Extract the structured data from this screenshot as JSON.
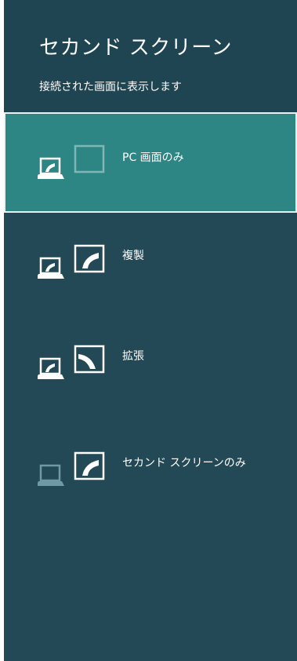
{
  "panel": {
    "title": "セカンド スクリーン",
    "subtitle": "接続された画面に表示します"
  },
  "options": [
    {
      "label": "PC 画面のみ",
      "icon": "pc-screen-only-icon",
      "selected": true
    },
    {
      "label": "複製",
      "icon": "duplicate-icon",
      "selected": false
    },
    {
      "label": "拡張",
      "icon": "extend-icon",
      "selected": false
    },
    {
      "label": "セカンド スクリーンのみ",
      "icon": "second-screen-only-icon",
      "selected": false
    }
  ],
  "colors": {
    "panel_background": "#224955",
    "header_background": "#1f4553",
    "selected_background": "#2d8584",
    "selected_border": "#e9f1f1",
    "dimmed_icon": "#6f9aa3"
  }
}
